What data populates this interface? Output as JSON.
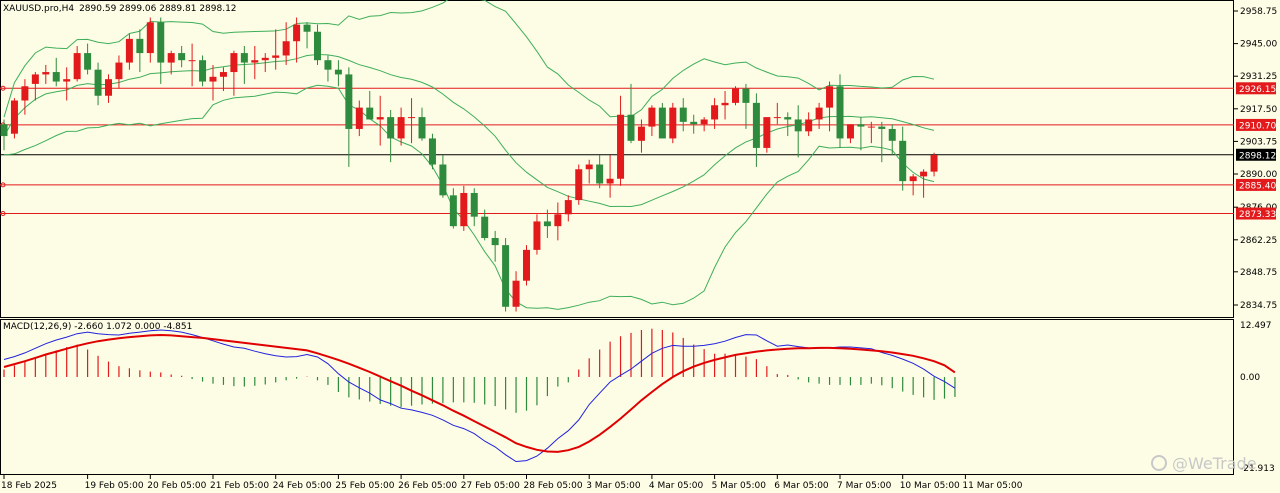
{
  "header": {
    "symbol_tf": "XAUUSD.pro,H4",
    "ohlc": "2890.59 2899.06 2889.81 2898.12",
    "macd_label": "MACD(12,26,9) -2.660 1.072 0.000 -4.851"
  },
  "watermark": "@WeTrade",
  "colors": {
    "background": "#fdfde6",
    "bull": "#e31a1c",
    "bear": "#2e8b3d",
    "bollinger": "#3fae5a",
    "levels": "#e31a1c",
    "macd_line": "#2222dd",
    "signal_line": "#e00000"
  },
  "chart_data": [
    {
      "type": "candlestick",
      "symbol": "XAUUSD.pro",
      "timeframe": "H4",
      "ylim": [
        2829.0,
        2963.0
      ],
      "y_ticks": [
        "2958.75",
        "2945.00",
        "2931.25",
        "2917.50",
        "2903.75",
        "2890.00",
        "2876.00",
        "2862.25",
        "2848.75",
        "2834.75"
      ],
      "x_ticks": [
        {
          "label": "18 Feb 2025",
          "bar": 0
        },
        {
          "label": "19 Feb 05:00",
          "bar": 8
        },
        {
          "label": "20 Feb 05:00",
          "bar": 14
        },
        {
          "label": "21 Feb 05:00",
          "bar": 20
        },
        {
          "label": "24 Feb 05:00",
          "bar": 26
        },
        {
          "label": "25 Feb 05:00",
          "bar": 32
        },
        {
          "label": "26 Feb 05:00",
          "bar": 38
        },
        {
          "label": "27 Feb 05:00",
          "bar": 44
        },
        {
          "label": "28 Feb 05:00",
          "bar": 50
        },
        {
          "label": "3 Mar 05:00",
          "bar": 56
        },
        {
          "label": "4 Mar 05:00",
          "bar": 62
        },
        {
          "label": "5 Mar 05:00",
          "bar": 68
        },
        {
          "label": "6 Mar 05:00",
          "bar": 74
        },
        {
          "label": "7 Mar 05:00",
          "bar": 80
        },
        {
          "label": "10 Mar 05:00",
          "bar": 86
        },
        {
          "label": "11 Mar 05:00",
          "bar": 92
        }
      ],
      "horizontal_levels": [
        {
          "price": 2926.15,
          "label": "2926.15"
        },
        {
          "price": 2910.7,
          "label": "2910.70"
        },
        {
          "price": 2885.4,
          "label": "2885.40"
        },
        {
          "price": 2873.33,
          "label": "2873.33"
        }
      ],
      "current_price": {
        "price": 2898.12,
        "label": "2898.12"
      },
      "candles": [
        [
          2911,
          2913,
          2900,
          2906
        ],
        [
          2907,
          2922,
          2905,
          2921
        ],
        [
          2921,
          2930,
          2915,
          2927
        ],
        [
          2928,
          2933,
          2921,
          2932
        ],
        [
          2932,
          2936,
          2928,
          2933
        ],
        [
          2933,
          2939,
          2927,
          2929
        ],
        [
          2929,
          2935,
          2921,
          2930
        ],
        [
          2930,
          2944,
          2929,
          2941
        ],
        [
          2941,
          2945,
          2932,
          2934
        ],
        [
          2934,
          2937,
          2919,
          2923
        ],
        [
          2923,
          2932,
          2920,
          2930
        ],
        [
          2930,
          2940,
          2926,
          2937
        ],
        [
          2937,
          2949,
          2934,
          2947
        ],
        [
          2947,
          2951,
          2933,
          2941
        ],
        [
          2941,
          2956,
          2937,
          2954
        ],
        [
          2954,
          2956,
          2928,
          2937
        ],
        [
          2937,
          2942,
          2932,
          2941
        ],
        [
          2941,
          2944,
          2935,
          2938
        ],
        [
          2938,
          2945,
          2927,
          2938
        ],
        [
          2938,
          2940,
          2927,
          2929
        ],
        [
          2929,
          2936,
          2921,
          2931
        ],
        [
          2931,
          2935,
          2925,
          2933
        ],
        [
          2933,
          2942,
          2923,
          2941
        ],
        [
          2941,
          2944,
          2928,
          2937
        ],
        [
          2937,
          2944,
          2930,
          2938
        ],
        [
          2938,
          2941,
          2933,
          2939
        ],
        [
          2939,
          2951,
          2934,
          2940
        ],
        [
          2940,
          2954,
          2936,
          2946
        ],
        [
          2946,
          2956,
          2937,
          2953
        ],
        [
          2953,
          2954,
          2943,
          2950
        ],
        [
          2950,
          2953,
          2936,
          2938
        ],
        [
          2938,
          2940,
          2929,
          2934
        ],
        [
          2934,
          2938,
          2927,
          2932
        ],
        [
          2932,
          2935,
          2893,
          2909
        ],
        [
          2909,
          2921,
          2906,
          2918
        ],
        [
          2918,
          2925,
          2913,
          2913
        ],
        [
          2913,
          2923,
          2902,
          2914
        ],
        [
          2914,
          2917,
          2895,
          2905
        ],
        [
          2905,
          2918,
          2902,
          2914
        ],
        [
          2914,
          2922,
          2903,
          2914
        ],
        [
          2914,
          2918,
          2904,
          2905
        ],
        [
          2905,
          2907,
          2892,
          2894
        ],
        [
          2894,
          2898,
          2880,
          2881
        ],
        [
          2881,
          2884,
          2867,
          2868
        ],
        [
          2868,
          2885,
          2866,
          2882
        ],
        [
          2882,
          2884,
          2868,
          2872
        ],
        [
          2872,
          2875,
          2862,
          2863
        ],
        [
          2863,
          2866,
          2853,
          2860
        ],
        [
          2860,
          2863,
          2832,
          2834
        ],
        [
          2834,
          2849,
          2832,
          2845
        ],
        [
          2845,
          2860,
          2843,
          2858
        ],
        [
          2858,
          2873,
          2856,
          2870
        ],
        [
          2870,
          2875,
          2863,
          2868
        ],
        [
          2868,
          2878,
          2862,
          2873
        ],
        [
          2873,
          2881,
          2870,
          2879
        ],
        [
          2879,
          2894,
          2877,
          2892
        ],
        [
          2892,
          2896,
          2886,
          2894
        ],
        [
          2894,
          2898,
          2884,
          2886
        ],
        [
          2886,
          2898,
          2880,
          2888
        ],
        [
          2888,
          2923,
          2885,
          2915
        ],
        [
          2915,
          2928,
          2903,
          2904
        ],
        [
          2904,
          2913,
          2899,
          2910
        ],
        [
          2910,
          2919,
          2906,
          2918
        ],
        [
          2918,
          2920,
          2905,
          2905
        ],
        [
          2905,
          2920,
          2903,
          2918
        ],
        [
          2918,
          2922,
          2908,
          2912
        ],
        [
          2912,
          2915,
          2907,
          2911
        ],
        [
          2911,
          2914,
          2908,
          2913
        ],
        [
          2913,
          2922,
          2909,
          2919
        ],
        [
          2919,
          2925,
          2913,
          2920
        ],
        [
          2920,
          2927,
          2919,
          2926
        ],
        [
          2926,
          2928,
          2909,
          2920
        ],
        [
          2920,
          2924,
          2893,
          2901
        ],
        [
          2901,
          2913,
          2899,
          2914
        ],
        [
          2914,
          2920,
          2911,
          2914
        ],
        [
          2914,
          2916,
          2906,
          2913
        ],
        [
          2913,
          2919,
          2897,
          2908
        ],
        [
          2908,
          2916,
          2906,
          2913
        ],
        [
          2913,
          2920,
          2909,
          2918
        ],
        [
          2918,
          2929,
          2908,
          2927
        ],
        [
          2927,
          2932,
          2901,
          2905
        ],
        [
          2905,
          2911,
          2903,
          2911
        ],
        [
          2911,
          2914,
          2900,
          2910
        ],
        [
          2910,
          2912,
          2903,
          2910
        ],
        [
          2910,
          2912,
          2895,
          2909
        ],
        [
          2909,
          2911,
          2898,
          2904
        ],
        [
          2904,
          2910,
          2883,
          2887
        ],
        [
          2887,
          2890,
          2881,
          2889
        ],
        [
          2889,
          2892,
          2880,
          2891
        ],
        [
          2891,
          2899,
          2889,
          2898
        ]
      ]
    },
    {
      "type": "histogram+line",
      "name": "MACD(12,26,9)",
      "ylim": [
        -21.913,
        12.497
      ],
      "y_ticks": [
        "12.497",
        "0.00",
        "-21.913"
      ],
      "histogram": [
        1.8,
        2.8,
        3.6,
        4.6,
        5.5,
        6.4,
        7.2,
        7.8,
        6.6,
        5.1,
        3.7,
        2.6,
        2.1,
        1.6,
        1.3,
        1.1,
        0.6,
        0.3,
        -0.5,
        -1.1,
        -1.6,
        -1.9,
        -2.2,
        -2.3,
        -2.1,
        -1.8,
        -1.3,
        -0.8,
        -0.4,
        0.1,
        -0.8,
        -1.9,
        -3.6,
        -4.9,
        -5.4,
        -5.9,
        -6.5,
        -6.9,
        -7.3,
        -6.9,
        -6.6,
        -6.4,
        -6.3,
        -6.1,
        -6.1,
        -6.2,
        -6.6,
        -7.0,
        -7.8,
        -8.6,
        -8.1,
        -6.8,
        -4.6,
        -2.3,
        -1.3,
        1.8,
        4.5,
        6.6,
        8.5,
        9.8,
        10.6,
        11.3,
        11.6,
        11.3,
        10.7,
        9.4,
        7.8,
        6.7,
        5.6,
        5.6,
        5.4,
        4.9,
        4.3,
        2.6,
        0.7,
        0.5,
        -0.6,
        -1.3,
        -1.6,
        -1.9,
        -1.9,
        -2.0,
        -1.9,
        -1.6,
        -2.0,
        -2.7,
        -3.5,
        -4.3,
        -4.9,
        -5.5,
        -5.2,
        -4.8
      ],
      "macd_line": [
        4.2,
        4.9,
        5.8,
        6.9,
        8.0,
        8.9,
        9.6,
        10.4,
        10.8,
        10.4,
        10.2,
        10.1,
        10.5,
        10.8,
        11.1,
        11.3,
        11.1,
        10.8,
        10.2,
        9.5,
        8.7,
        7.9,
        7.2,
        6.9,
        6.2,
        5.6,
        5.1,
        4.8,
        4.9,
        5.4,
        4.8,
        3.2,
        0.8,
        -1.2,
        -2.6,
        -3.9,
        -5.5,
        -6.4,
        -7.5,
        -7.9,
        -8.5,
        -9.2,
        -10.3,
        -11.6,
        -12.4,
        -13.6,
        -15.4,
        -16.8,
        -18.7,
        -20.3,
        -20.1,
        -19.0,
        -17.1,
        -14.8,
        -12.9,
        -10.3,
        -6.6,
        -3.9,
        -1.2,
        0.4,
        1.9,
        3.8,
        5.7,
        6.9,
        7.6,
        7.4,
        7.4,
        7.6,
        8.0,
        8.6,
        9.5,
        10.2,
        10.1,
        8.7,
        7.4,
        7.7,
        7.3,
        7.0,
        6.9,
        7.0,
        7.2,
        7.2,
        7.0,
        6.8,
        5.9,
        5.2,
        4.3,
        3.3,
        1.9,
        0.2,
        -1.1,
        -2.7
      ],
      "signal_line": [
        2.4,
        3.1,
        3.8,
        4.6,
        5.4,
        6.1,
        6.8,
        7.5,
        8.1,
        8.6,
        9.0,
        9.3,
        9.6,
        9.8,
        10.0,
        10.1,
        10.0,
        9.8,
        9.6,
        9.4,
        9.1,
        8.8,
        8.5,
        8.2,
        7.9,
        7.6,
        7.3,
        7.0,
        6.7,
        6.4,
        5.7,
        4.9,
        4.1,
        3.2,
        2.2,
        1.2,
        0.1,
        -1.0,
        -2.1,
        -3.3,
        -4.4,
        -5.6,
        -6.8,
        -8.1,
        -9.3,
        -10.6,
        -11.9,
        -13.2,
        -14.5,
        -15.9,
        -16.8,
        -17.5,
        -17.9,
        -18.0,
        -17.6,
        -16.8,
        -15.5,
        -13.9,
        -12.0,
        -10.0,
        -7.8,
        -5.6,
        -3.6,
        -1.7,
        0.0,
        1.4,
        2.5,
        3.4,
        4.1,
        4.7,
        5.3,
        5.7,
        6.1,
        6.4,
        6.6,
        6.8,
        6.9,
        6.9,
        7.0,
        7.0,
        6.9,
        6.8,
        6.6,
        6.4,
        6.2,
        5.9,
        5.5,
        5.1,
        4.5,
        3.8,
        2.8,
        1.1
      ]
    }
  ]
}
